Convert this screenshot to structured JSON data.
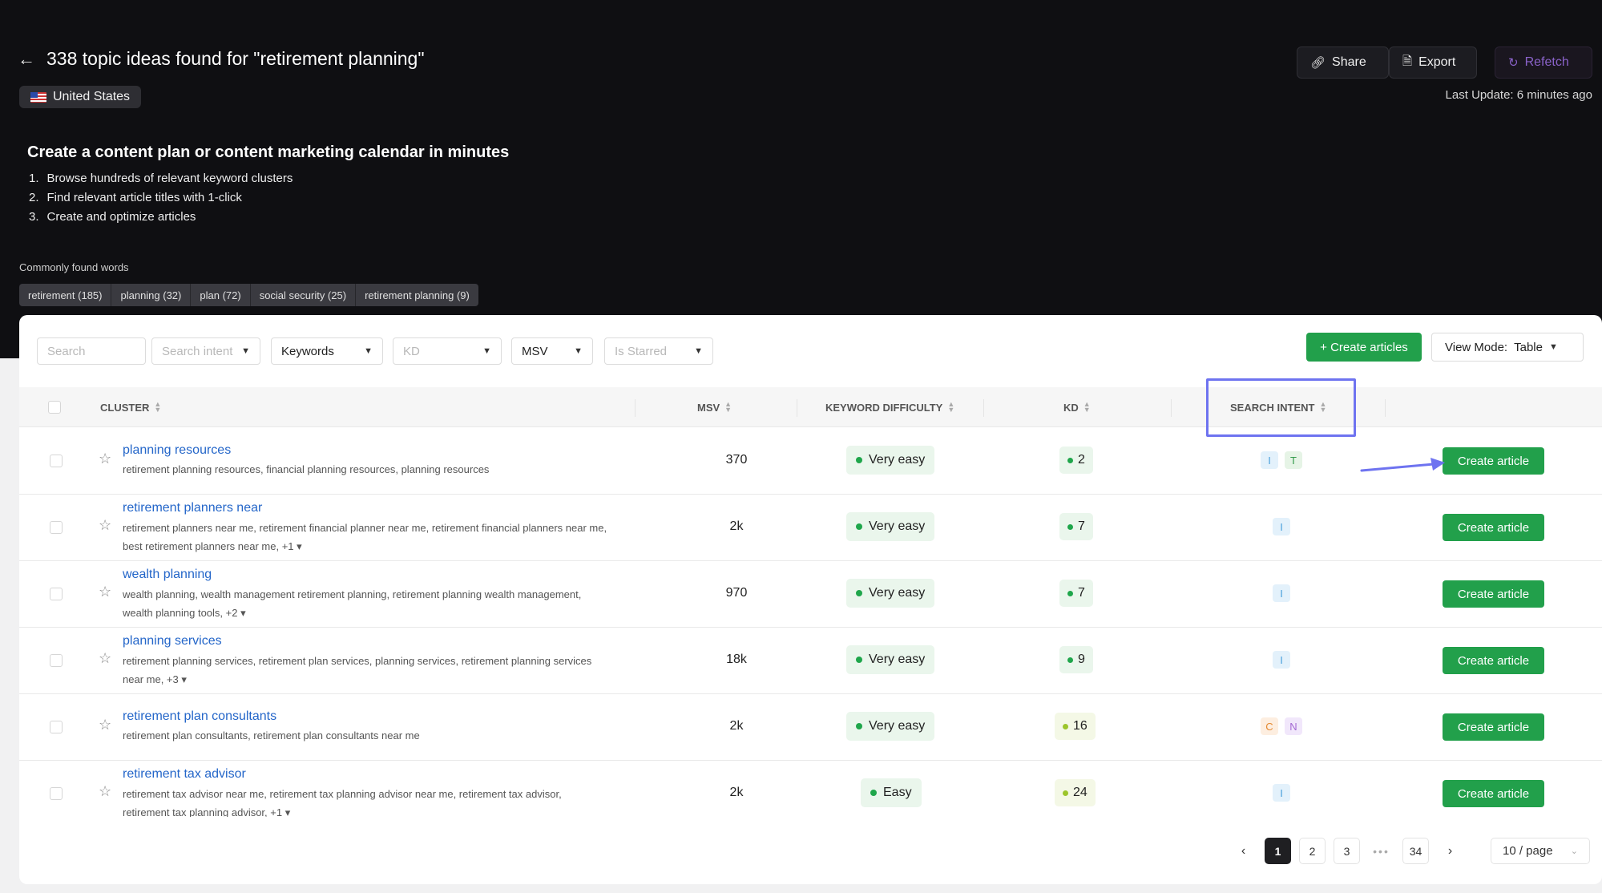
{
  "header": {
    "back_icon": "arrow-left-icon",
    "title": "338 topic ideas found for \"retirement planning\"",
    "country": "United States",
    "share_label": "Share",
    "export_label": "Export",
    "refetch_label": "Refetch",
    "last_update": "Last Update: 6 minutes ago"
  },
  "promo": {
    "heading": "Create a content plan or content marketing calendar in minutes",
    "steps": [
      "Browse hundreds of relevant keyword clusters",
      "Find relevant article titles with 1-click",
      "Create and optimize articles"
    ]
  },
  "common_words": {
    "label": "Commonly found words",
    "tags": [
      "retirement (185)",
      "planning (32)",
      "plan (72)",
      "social security (25)",
      "retirement planning (9)"
    ]
  },
  "filters": {
    "search_placeholder": "Search",
    "intent_placeholder": "Search intent",
    "keywords": "Keywords",
    "kd_placeholder": "KD",
    "msv": "MSV",
    "starred_placeholder": "Is Starred",
    "create_articles": "+ Create articles",
    "view_mode_label": "View Mode:",
    "view_mode_value": "Table"
  },
  "table": {
    "headers": {
      "cluster": "CLUSTER",
      "msv": "MSV",
      "difficulty": "KEYWORD DIFFICULTY",
      "kd": "KD",
      "intent": "SEARCH INTENT"
    },
    "action_label": "Create article",
    "rows": [
      {
        "title": "planning resources",
        "kw_line1": "retirement planning resources, financial planning resources, planning resources",
        "kw_line2": "",
        "msv": "370",
        "difficulty": "Very easy",
        "kd": "2",
        "intent": [
          "I",
          "T"
        ]
      },
      {
        "title": "retirement planners near",
        "kw_line1": "retirement planners near me, retirement financial planner near me, retirement financial planners near me,",
        "kw_line2": "best retirement planners near me, +1",
        "msv": "2k",
        "difficulty": "Very easy",
        "kd": "7",
        "intent": [
          "I"
        ]
      },
      {
        "title": "wealth planning",
        "kw_line1": "wealth planning, wealth management retirement planning, retirement planning wealth management,",
        "kw_line2": "wealth planning tools, +2",
        "msv": "970",
        "difficulty": "Very easy",
        "kd": "7",
        "intent": [
          "I"
        ]
      },
      {
        "title": "planning services",
        "kw_line1": "retirement planning services, retirement plan services, planning services, retirement planning services",
        "kw_line2": "near me, +3",
        "msv": "18k",
        "difficulty": "Very easy",
        "kd": "9",
        "intent": [
          "I"
        ]
      },
      {
        "title": "retirement plan consultants",
        "kw_line1": "retirement plan consultants, retirement plan consultants near me",
        "kw_line2": "",
        "msv": "2k",
        "difficulty": "Very easy",
        "kd": "16",
        "intent": [
          "C",
          "N"
        ]
      },
      {
        "title": "retirement tax advisor",
        "kw_line1": "retirement tax advisor near me, retirement tax planning advisor near me, retirement tax advisor,",
        "kw_line2": "retirement tax planning advisor, +1",
        "msv": "2k",
        "difficulty": "Easy",
        "kd": "24",
        "intent": [
          "I"
        ]
      }
    ]
  },
  "pagination": {
    "pages": [
      "1",
      "2",
      "3"
    ],
    "last_page": "34",
    "current": "1",
    "per_page": "10 / page"
  },
  "colors": {
    "accent_green": "#22a04b",
    "highlight_box": "#6e73f0",
    "link_blue": "#2466c9"
  }
}
